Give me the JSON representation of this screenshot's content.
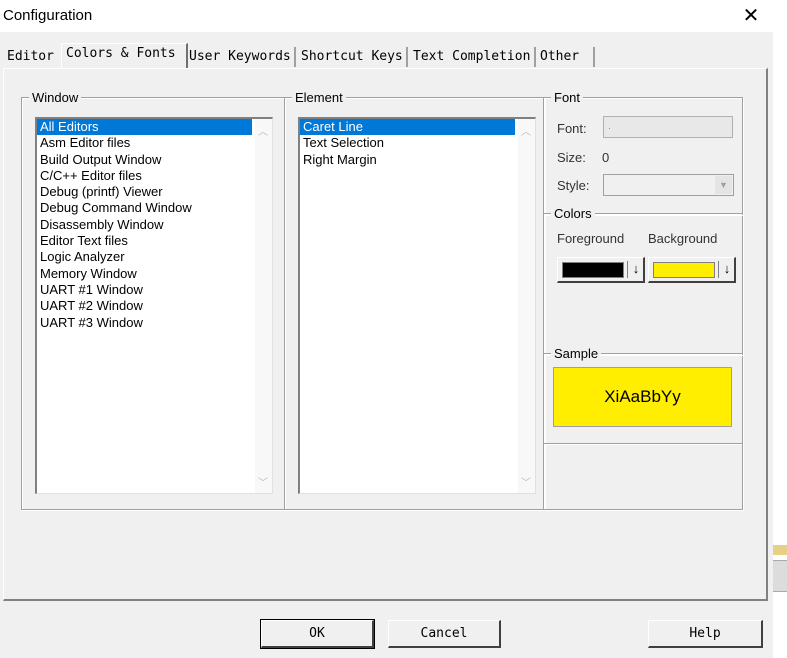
{
  "window": {
    "title": "Configuration",
    "close_glyph": "✕"
  },
  "tabs": [
    {
      "label": "Editor",
      "active": false
    },
    {
      "label": "Colors & Fonts",
      "active": true
    },
    {
      "label": "User Keywords",
      "active": false
    },
    {
      "label": "Shortcut Keys",
      "active": false
    },
    {
      "label": "Text Completion",
      "active": false
    },
    {
      "label": "Other",
      "active": false
    }
  ],
  "window_group": {
    "label": "Window",
    "items": [
      "All Editors",
      "Asm Editor files",
      "Build Output Window",
      "C/C++ Editor files",
      "Debug (printf) Viewer",
      "Debug Command Window",
      "Disassembly Window",
      "Editor Text files",
      "Logic Analyzer",
      "Memory Window",
      "UART #1 Window",
      "UART #2 Window",
      "UART #3 Window"
    ],
    "selected_index": 0
  },
  "element_group": {
    "label": "Element",
    "items": [
      "Caret Line",
      "Text Selection",
      "Right Margin"
    ],
    "selected_index": 0
  },
  "font_group": {
    "label": "Font",
    "font_label": "Font:",
    "font_value": "·",
    "size_label": "Size:",
    "size_value": "0",
    "style_label": "Style:",
    "style_value": ""
  },
  "colors_group": {
    "label": "Colors",
    "foreground_label": "Foreground",
    "background_label": "Background",
    "foreground_color": "#000000",
    "background_color": "#ffee00",
    "dropdown_glyph": "↓"
  },
  "sample_group": {
    "label": "Sample",
    "text": "XiAaBbYy",
    "bg_color": "#ffee00",
    "fg_color": "#000000"
  },
  "buttons": {
    "ok": "OK",
    "cancel": "Cancel",
    "help": "Help"
  }
}
